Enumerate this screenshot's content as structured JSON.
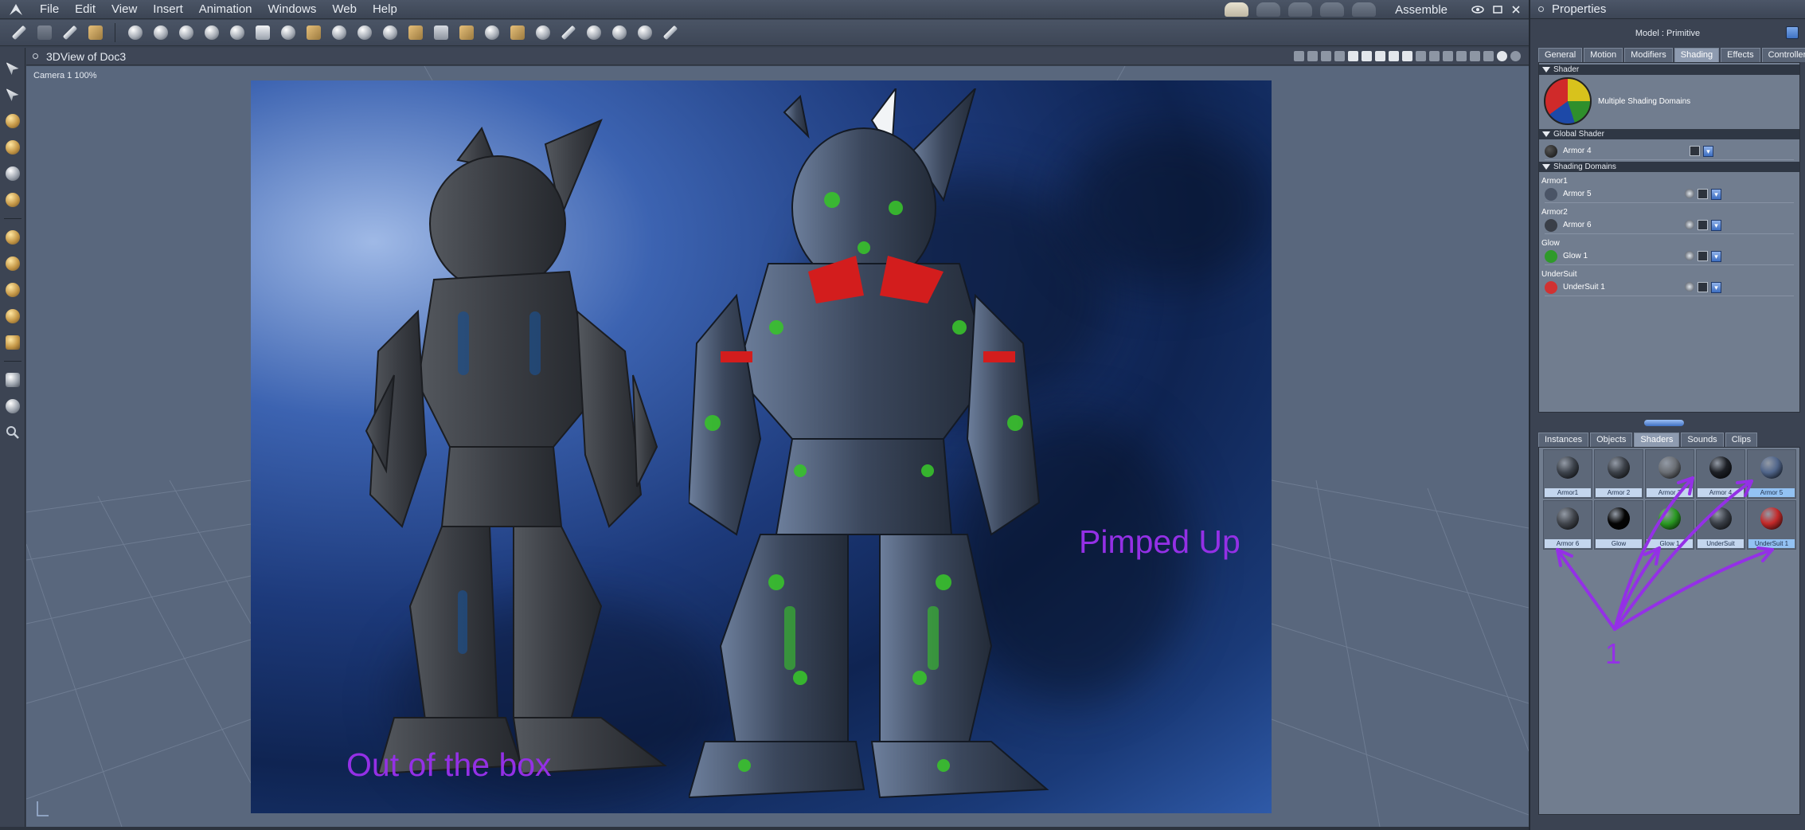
{
  "menubar": {
    "items": [
      "File",
      "Edit",
      "View",
      "Insert",
      "Animation",
      "Windows",
      "Web",
      "Help"
    ],
    "workspace": "Assemble",
    "window_controls": [
      "eye-icon",
      "minimize-icon",
      "close-icon"
    ]
  },
  "toolbar": {
    "icons": [
      "pencil-icon",
      "hand-icon",
      "brush-icon",
      "material-icon",
      "sphere-icon",
      "bone-icon",
      "geosphere-icon",
      "joint-icon",
      "torus-icon",
      "text-icon",
      "gear-icon",
      "plane-icon",
      "pin-icon",
      "lathe-icon",
      "glove-icon",
      "grid-icon",
      "ago-icon",
      "house-icon",
      "cylinder-icon",
      "hand-open-icon",
      "hand-point-icon",
      "pen-icon",
      "spider-icon",
      "network-icon",
      "target-icon",
      "wrench-icon"
    ]
  },
  "viewport": {
    "title": "3DView of Doc3",
    "camera": "Camera 1 100%"
  },
  "annotations": {
    "left_label": "Out of the box",
    "right_label": "Pimped Up",
    "arrow_label": "1"
  },
  "properties": {
    "title": "Properties",
    "model": "Model : Primitive",
    "tabs": [
      "General",
      "Motion",
      "Modifiers",
      "Shading",
      "Effects",
      "Controllers"
    ],
    "active_tab": "Shading",
    "shader_section": "Shader",
    "shader_name": "Multiple Shading Domains",
    "global_section": "Global Shader",
    "global_shader": "Armor 4",
    "domains_section": "Shading Domains",
    "domains": [
      {
        "domain": "Armor1",
        "shader": "Armor 5",
        "color": "#4a5466"
      },
      {
        "domain": "Armor2",
        "shader": "Armor 6",
        "color": "#3a3f48"
      },
      {
        "domain": "Glow",
        "shader": "Glow 1",
        "color": "#2f9a2a"
      },
      {
        "domain": "UnderSuit",
        "shader": "UnderSuit 1",
        "color": "#d13232"
      }
    ]
  },
  "library": {
    "tabs": [
      "Instances",
      "Objects",
      "Shaders",
      "Sounds",
      "Clips"
    ],
    "active_tab": "Shaders",
    "items": [
      {
        "name": "Armor1",
        "color": "#3d434c",
        "selected": false
      },
      {
        "name": "Armor 2",
        "color": "#3c4149",
        "selected": false
      },
      {
        "name": "Armor 3",
        "color": "#6a6e74",
        "selected": false
      },
      {
        "name": "Armor 4",
        "color": "#1c1f25",
        "selected": false
      },
      {
        "name": "Armor 5",
        "color": "#50658a",
        "selected": true
      },
      {
        "name": "Armor 6",
        "color": "#42464d",
        "selected": false
      },
      {
        "name": "Glow",
        "color": "#050505",
        "selected": false
      },
      {
        "name": "Glow 1",
        "color": "#2a9a22",
        "selected": false
      },
      {
        "name": "UnderSuit",
        "color": "#3a3f47",
        "selected": false
      },
      {
        "name": "UnderSuit 1",
        "color": "#c42a2a",
        "selected": true
      }
    ]
  }
}
